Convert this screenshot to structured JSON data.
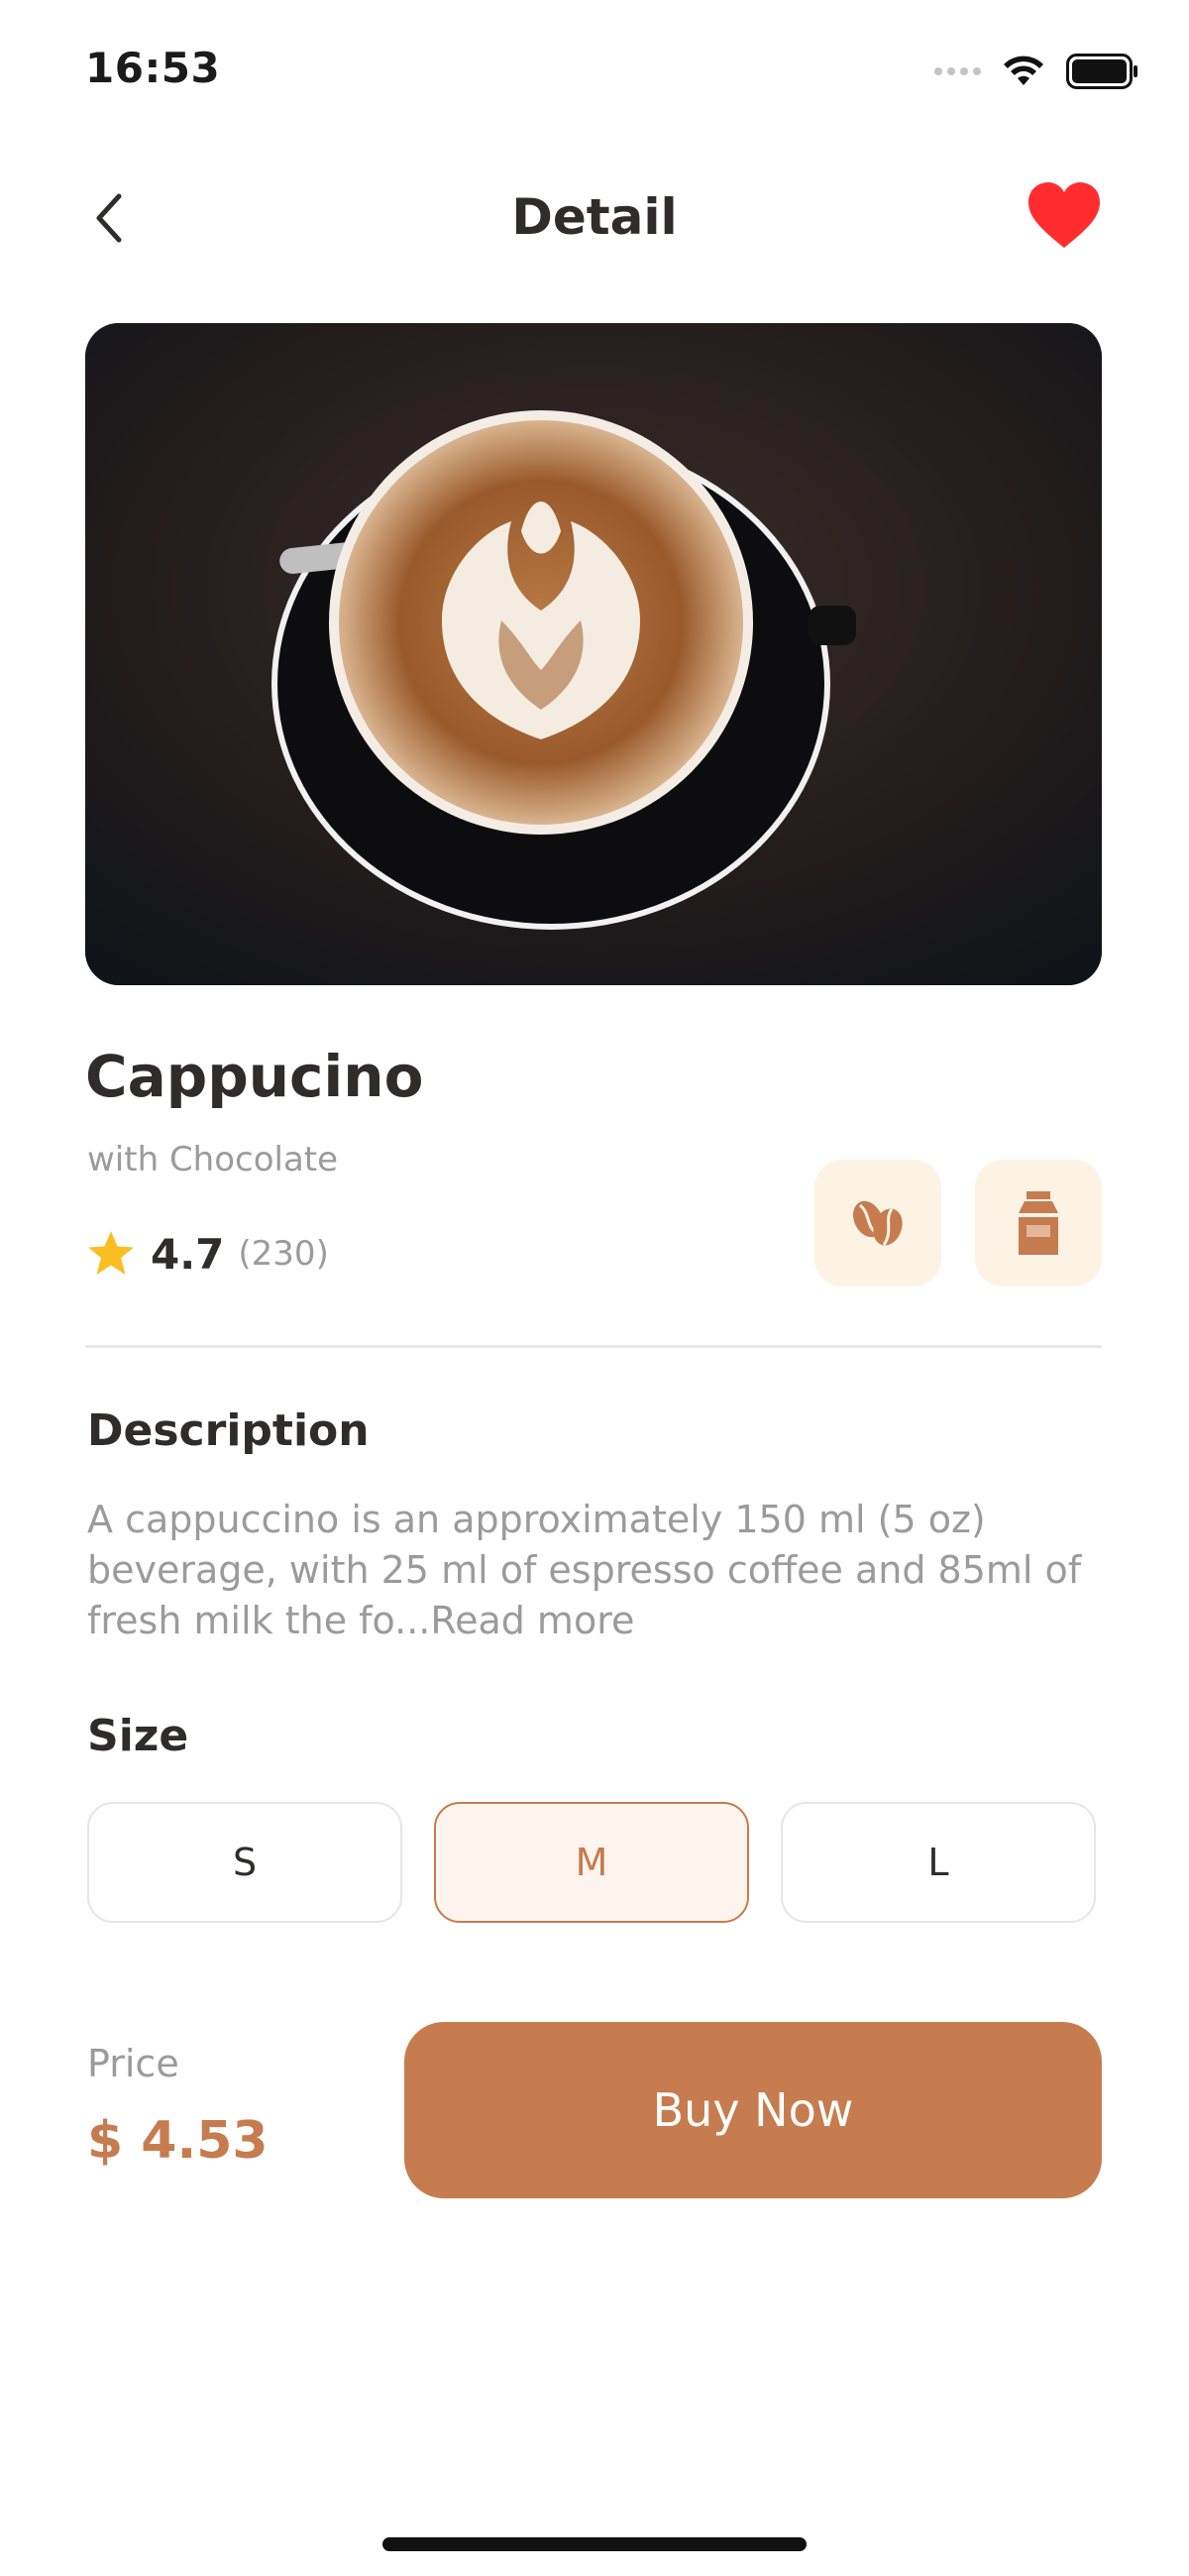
{
  "status_bar": {
    "time": "16:53"
  },
  "header": {
    "title": "Detail",
    "back_icon": "chevron-left-icon",
    "favorite_icon": "heart-icon",
    "favorite_color": "#ff2d2d"
  },
  "product": {
    "name": "Cappucino",
    "subtitle": "with Chocolate",
    "rating": "4.7",
    "rating_count": "(230)",
    "badges": [
      "coffee-beans-icon",
      "milk-carton-icon"
    ]
  },
  "description": {
    "title": "Description",
    "text": "A cappuccino is an approximately 150 ml (5 oz) beverage, with 25 ml of espresso coffee and 85ml of fresh milk the fo...",
    "read_more": "Read more"
  },
  "size": {
    "title": "Size",
    "options": [
      "S",
      "M",
      "L"
    ],
    "selected": "M"
  },
  "purchase": {
    "price_label": "Price",
    "price": "$ 4.53",
    "buy_label": "Buy Now"
  },
  "colors": {
    "accent": "#c67c4e",
    "badge_bg": "#fdf3e4",
    "star": "#fbbe21",
    "text_primary": "#2f2d2c",
    "text_secondary": "#9b9b9b"
  }
}
